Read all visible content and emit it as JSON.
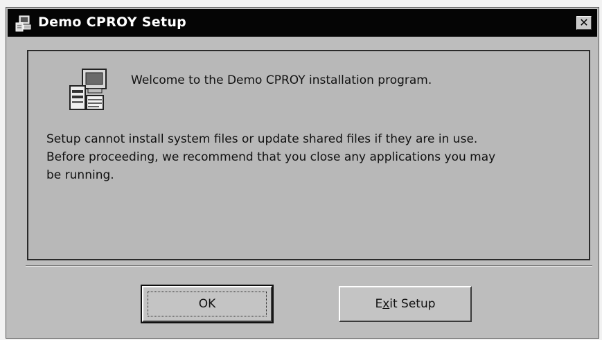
{
  "window": {
    "title": "Demo CPROY Setup",
    "close_symbol": "✕"
  },
  "content": {
    "welcome_text": "Welcome to the Demo CPROY installation program.",
    "message_line1": "Setup cannot install system files or update shared files if they are in use.",
    "message_line2": "Before proceeding, we recommend that you close any applications you may",
    "message_line3": "be running."
  },
  "buttons": {
    "ok_label": "OK",
    "exit_pre": "E",
    "exit_mnemonic": "x",
    "exit_post": "it Setup"
  },
  "icons": {
    "title": "setup-computer-icon",
    "content": "setup-computer-icon"
  }
}
